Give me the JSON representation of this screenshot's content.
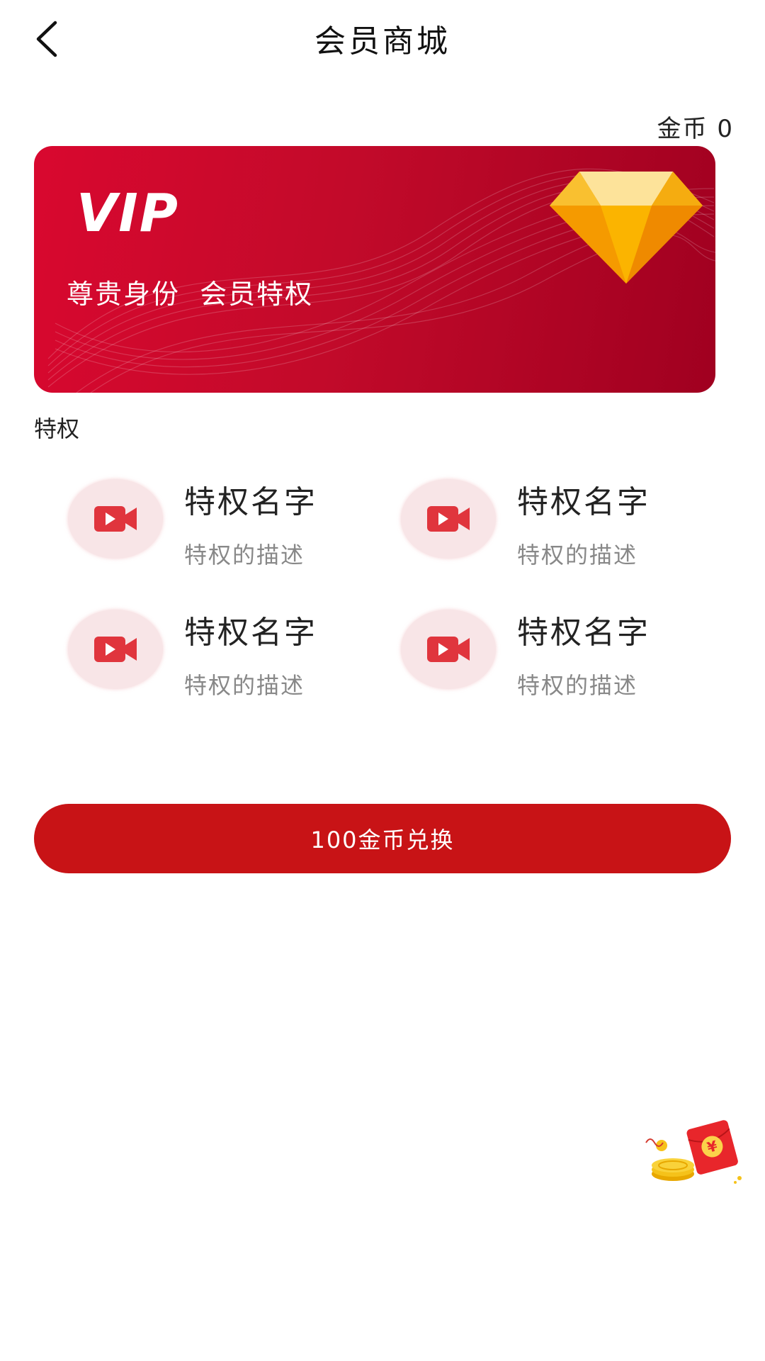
{
  "header": {
    "title": "会员商城"
  },
  "wallet": {
    "coins_label": "金币 0"
  },
  "vip_card": {
    "logo_text": "VIP",
    "slogan": "尊贵身份  会员特权",
    "card_color": "#c8102e",
    "gem_color": "#f7a400"
  },
  "privileges": {
    "section_label": "特权",
    "items": [
      {
        "name": "特权名字",
        "desc": "特权的描述",
        "icon": "video-camera-icon"
      },
      {
        "name": "特权名字",
        "desc": "特权的描述",
        "icon": "video-camera-icon"
      },
      {
        "name": "特权名字",
        "desc": "特权的描述",
        "icon": "video-camera-icon"
      },
      {
        "name": "特权名字",
        "desc": "特权的描述",
        "icon": "video-camera-icon"
      }
    ]
  },
  "actions": {
    "exchange_label": "100金币兑换",
    "accent_color": "#c81316"
  },
  "floating": {
    "icon": "red-packet-icon"
  }
}
